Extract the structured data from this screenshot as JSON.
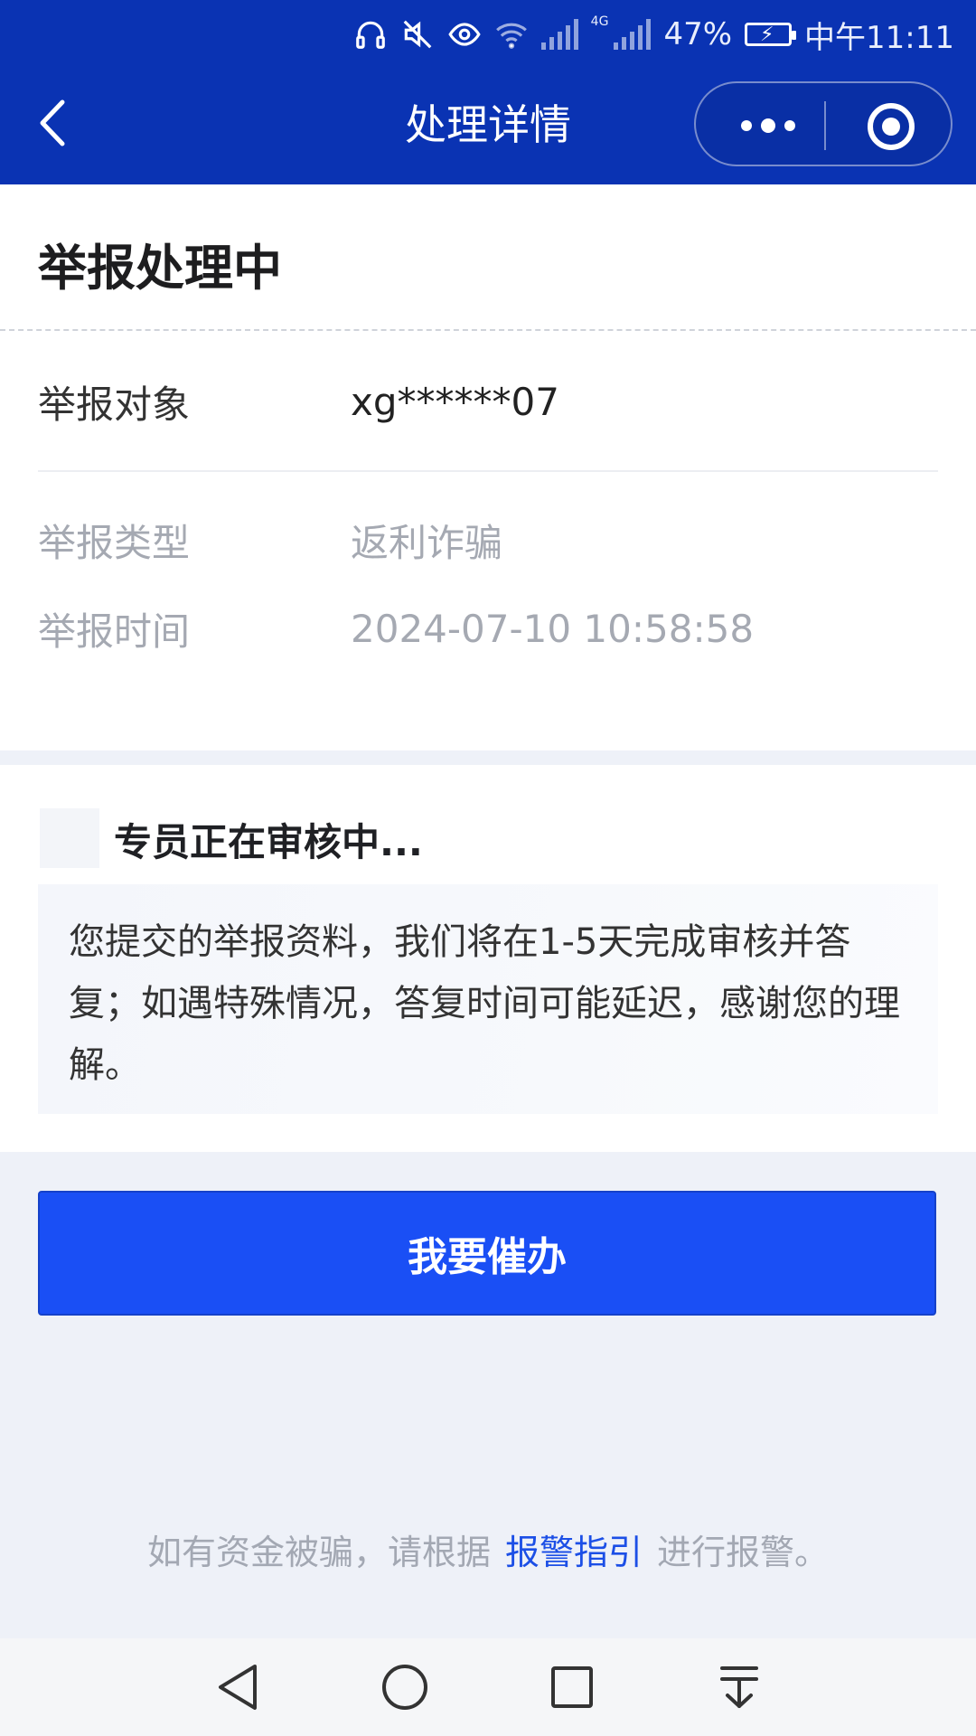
{
  "status_bar": {
    "battery_percent": "47%",
    "time": "中午11:11",
    "network": "4G"
  },
  "header": {
    "title": "处理详情"
  },
  "report": {
    "status_heading": "举报处理中",
    "fields": [
      {
        "label": "举报对象",
        "value": "xg******07"
      },
      {
        "label": "举报类型",
        "value": "返利诈骗"
      },
      {
        "label": "举报时间",
        "value": "2024-07-10 10:58:58"
      }
    ]
  },
  "review": {
    "title": "专员正在审核中...",
    "message": "您提交的举报资料，我们将在1-5天完成审核并答复；如遇特殊情况，答复时间可能延迟，感谢您的理解。"
  },
  "actions": {
    "urge_label": "我要催办"
  },
  "footer": {
    "prefix": "如有资金被骗，请根据",
    "link": "报警指引",
    "suffix": "进行报警。"
  },
  "colors": {
    "header_bg": "#0a33b3",
    "primary_button": "#1a4ff5",
    "link": "#1c4fe6"
  }
}
